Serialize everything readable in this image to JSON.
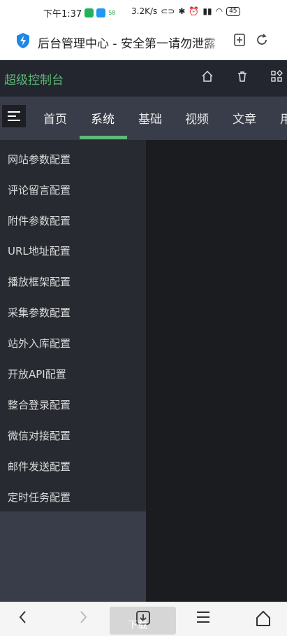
{
  "status_bar": {
    "time": "下午1:37",
    "app_badge": "58",
    "net_speed": "3.2K/s",
    "battery": "45"
  },
  "browser": {
    "page_title": "后台管理中心 - 安全第一请勿泄露",
    "icons": [
      "shield-bolt-icon",
      "bookmark-add-icon",
      "refresh-icon"
    ]
  },
  "app": {
    "brand": "超级控制台",
    "brand_color": "#5fb878",
    "header_icons": [
      "home-icon",
      "trash-icon",
      "apps-icon"
    ]
  },
  "nav": {
    "tabs": [
      {
        "label": "首页"
      },
      {
        "label": "系统"
      },
      {
        "label": "基础"
      },
      {
        "label": "视频"
      },
      {
        "label": "文章"
      },
      {
        "label": "用"
      }
    ],
    "active": "系统"
  },
  "sidebar": {
    "items": [
      {
        "label": "网站参数配置"
      },
      {
        "label": "评论留言配置"
      },
      {
        "label": "附件参数配置"
      },
      {
        "label": "URL地址配置"
      },
      {
        "label": "播放框架配置"
      },
      {
        "label": "采集参数配置"
      },
      {
        "label": "站外入库配置"
      },
      {
        "label": "开放API配置"
      },
      {
        "label": "整合登录配置"
      },
      {
        "label": "微信对接配置"
      },
      {
        "label": "邮件发送配置"
      },
      {
        "label": "定时任务配置"
      }
    ]
  },
  "bottom_nav": {
    "download_label": "下载",
    "icons": [
      "back-icon",
      "forward-icon",
      "download-icon",
      "menu-icon",
      "home-icon"
    ]
  }
}
